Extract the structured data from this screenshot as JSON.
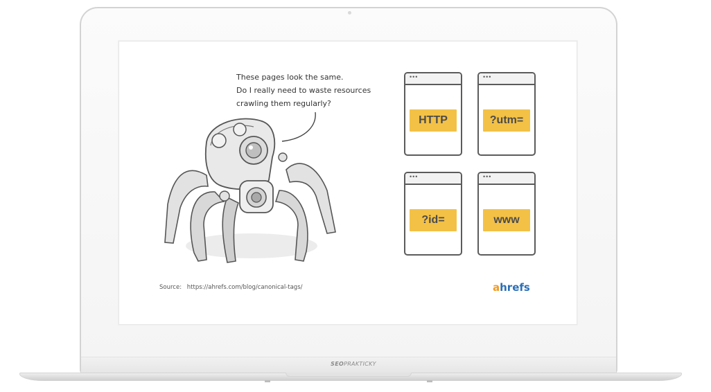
{
  "speech": {
    "lines": [
      "These pages look the same.",
      "Do I really need to waste resources",
      "crawling them regularly?"
    ]
  },
  "pages": [
    {
      "dots": "•••",
      "label": "HTTP"
    },
    {
      "dots": "•••",
      "label": "?utm="
    },
    {
      "dots": "•••",
      "label": "?id="
    },
    {
      "dots": "•••",
      "label": "www"
    }
  ],
  "source": {
    "label": "Source:",
    "url": "https://ahrefs.com/blog/canonical-tags/"
  },
  "logo": {
    "first": "a",
    "rest": "hrefs"
  },
  "laptop_brand": {
    "bold": "SEO",
    "normal": "PRAKTICKY"
  },
  "colors": {
    "label_bg": "#f3c146",
    "logo_blue": "#2c6fb7",
    "logo_orange": "#f29b1f"
  },
  "icons": [
    "spider-robot-illustration",
    "speech-bubble-tail-icon",
    "window-dots-icon"
  ]
}
